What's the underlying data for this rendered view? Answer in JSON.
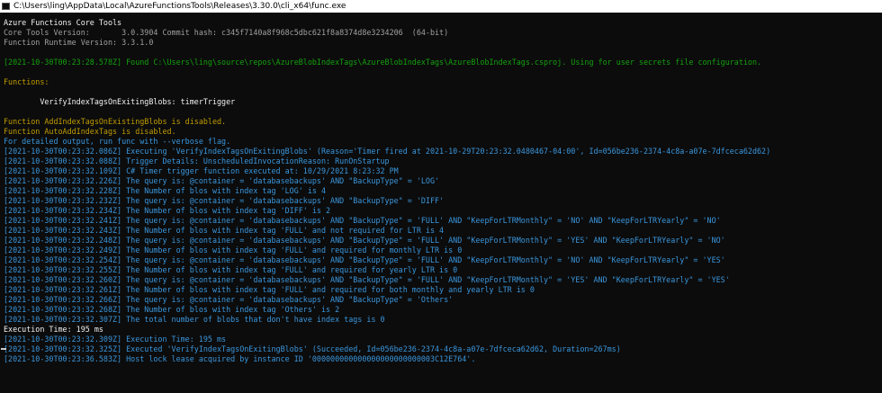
{
  "colors": {
    "default": "#cccccc",
    "gray": "#a0a0a0",
    "green": "#13a10e",
    "yellow": "#c19c00",
    "cyan": "#3a96dd",
    "white": "#f2f2f2",
    "background": "#0c0c0c"
  },
  "window": {
    "icon": "console-app-icon",
    "title": "C:\\Users\\ling\\AppData\\Local\\AzureFunctionsTools\\Releases\\3.30.0\\cli_x64\\func.exe"
  },
  "console": {
    "lines": [
      {
        "text": "Azure Functions Core Tools",
        "color": "white",
        "row": 0
      },
      {
        "text": "Core Tools Version:       3.0.3904 Commit hash: c345f7140a8f968c5dbc621f8a8374d8e3234206  (64-bit)",
        "color": "gray",
        "row": 1
      },
      {
        "text": "Function Runtime Version: 3.3.1.0",
        "color": "gray",
        "row": 2
      },
      {
        "text": "[2021-10-30T00:23:28.578Z] Found C:\\Users\\ling\\source\\repos\\AzureBlobIndexTags\\AzureBlobIndexTags\\AzureBlobIndexTags.csproj. Using for user secrets file configuration.",
        "color": "green",
        "row": 4
      },
      {
        "text": "Functions:",
        "color": "yellow",
        "row": 6
      },
      {
        "text": "        VerifyIndexTagsOnExitingBlobs: timerTrigger",
        "color": "white",
        "row": 8
      },
      {
        "text": "Function AddIndexTagsOnExistingBlobs is disabled.",
        "color": "yellow",
        "row": 10
      },
      {
        "text": "Function AutoAddIndexTags is disabled.",
        "color": "yellow",
        "row": 11
      },
      {
        "text": "For detailed output, run func with --verbose flag.",
        "color": "cyan",
        "row": 12
      },
      {
        "text": "[2021-10-30T00:23:32.086Z] Executing 'VerifyIndexTagsOnExitingBlobs' (Reason='Timer fired at 2021-10-29T20:23:32.0480467-04:00', Id=056be236-2374-4c8a-a07e-7dfceca62d62)",
        "color": "cyan",
        "row": 13
      },
      {
        "text": "[2021-10-30T00:23:32.088Z] Trigger Details: UnscheduledInvocationReason: RunOnStartup",
        "color": "cyan",
        "row": 14
      },
      {
        "text": "[2021-10-30T00:23:32.109Z] C# Timer trigger function executed at: 10/29/2021 8:23:32 PM",
        "color": "cyan",
        "row": 15
      },
      {
        "text": "[2021-10-30T00:23:32.226Z] The query is: @container = 'databasebackups' AND \"BackupType\" = 'LOG'",
        "color": "cyan",
        "row": 16
      },
      {
        "text": "[2021-10-30T00:23:32.228Z] The Number of blos with index tag 'LOG' is 4",
        "color": "cyan",
        "row": 17
      },
      {
        "text": "[2021-10-30T00:23:32.232Z] The query is: @container = 'databasebackups' AND \"BackupType\" = 'DIFF'",
        "color": "cyan",
        "row": 18
      },
      {
        "text": "[2021-10-30T00:23:32.234Z] The Number of blos with index tag 'DIFF' is 2",
        "color": "cyan",
        "row": 19
      },
      {
        "text": "[2021-10-30T00:23:32.241Z] The query is: @container = 'databasebackups' AND \"BackupType\" = 'FULL' AND \"KeepForLTRMonthly\" = 'NO' AND \"KeepForLTRYearly\" = 'NO'",
        "color": "cyan",
        "row": 20
      },
      {
        "text": "[2021-10-30T00:23:32.243Z] The Number of blos with index tag 'FULL' and not required for LTR is 4",
        "color": "cyan",
        "row": 21
      },
      {
        "text": "[2021-10-30T00:23:32.248Z] The query is: @container = 'databasebackups' AND \"BackupType\" = 'FULL' AND \"KeepForLTRMonthly\" = 'YES' AND \"KeepForLTRYearly\" = 'NO'",
        "color": "cyan",
        "row": 22
      },
      {
        "text": "[2021-10-30T00:23:32.249Z] The Number of blos with index tag 'FULL' and required for monthly LTR is 0",
        "color": "cyan",
        "row": 23
      },
      {
        "text": "[2021-10-30T00:23:32.254Z] The query is: @container = 'databasebackups' AND \"BackupType\" = 'FULL' AND \"KeepForLTRMonthly\" = 'NO' AND \"KeepForLTRYearly\" = 'YES'",
        "color": "cyan",
        "row": 24
      },
      {
        "text": "[2021-10-30T00:23:32.255Z] The Number of blos with index tag 'FULL' and required for yearly LTR is 0",
        "color": "cyan",
        "row": 25
      },
      {
        "text": "[2021-10-30T00:23:32.260Z] The query is: @container = 'databasebackups' AND \"BackupType\" = 'FULL' AND \"KeepForLTRMonthly\" = 'YES' AND \"KeepForLTRYearly\" = 'YES'",
        "color": "cyan",
        "row": 26
      },
      {
        "text": "[2021-10-30T00:23:32.261Z] The Number of blos with index tag 'FULL' and required for both monthly and yearly LTR is 0",
        "color": "cyan",
        "row": 27
      },
      {
        "text": "[2021-10-30T00:23:32.266Z] The query is: @container = 'databasebackups' AND \"BackupType\" = 'Others'",
        "color": "cyan",
        "row": 28
      },
      {
        "text": "[2021-10-30T00:23:32.268Z] The Number of blos with index tag 'Others' is 2",
        "color": "cyan",
        "row": 29
      },
      {
        "text": "[2021-10-30T00:23:32.307Z] The total number of blobs that don't have index tags is 0",
        "color": "cyan",
        "row": 30
      },
      {
        "text": "Execution Time: 195 ms",
        "color": "white",
        "row": 31
      },
      {
        "text": "[2021-10-30T00:23:32.309Z] Execution Time: 195 ms",
        "color": "cyan",
        "row": 32
      },
      {
        "text": "[2021-10-30T00:23:32.325Z] Executed 'VerifyIndexTagsOnExitingBlobs' (Succeeded, Id=056be236-2374-4c8a-a07e-7dfceca62d62, Duration=267ms)",
        "color": "cyan",
        "row": 33
      },
      {
        "text": "[2021-10-30T00:23:36.583Z] Host lock lease acquired by instance ID '000000000000000000000000003C12E764'.",
        "color": "cyan",
        "row": 34
      }
    ]
  }
}
